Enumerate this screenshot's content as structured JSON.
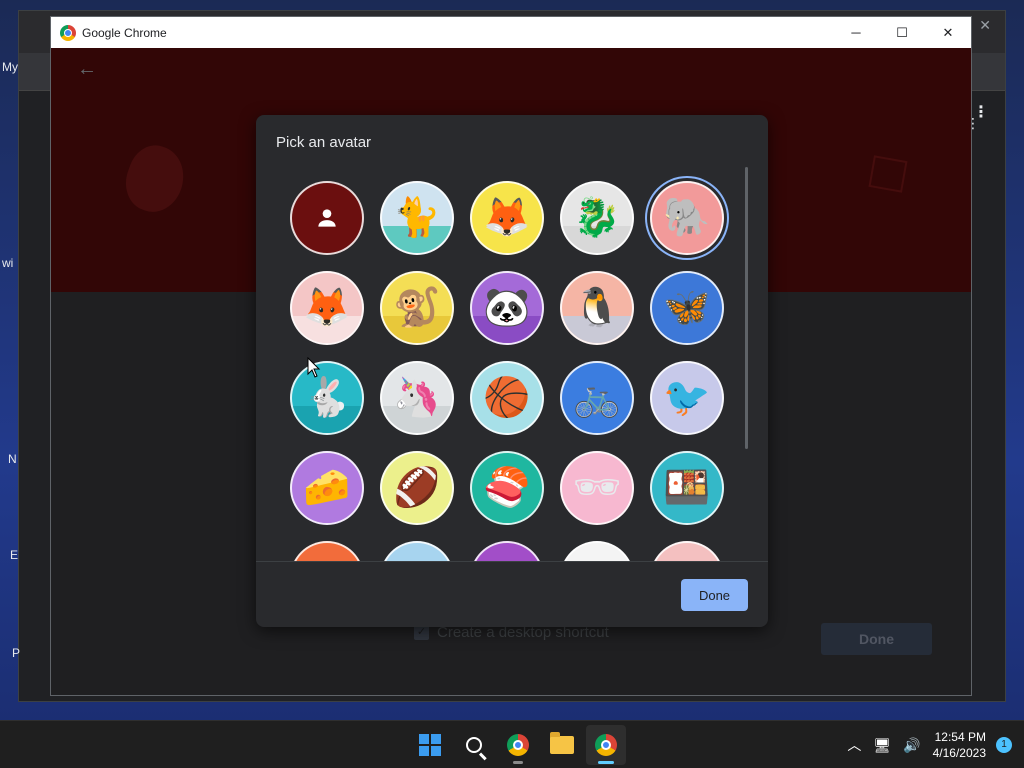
{
  "window": {
    "title": "Google Chrome"
  },
  "background": {
    "left_labels": [
      "My",
      "wi",
      "N",
      "E",
      "P"
    ]
  },
  "page": {
    "shortcut_label": "Create a desktop shortcut",
    "done_label": "Done"
  },
  "dialog": {
    "title": "Pick an avatar",
    "done_label": "Done",
    "avatars": [
      {
        "name": "generic-person",
        "glyph": "",
        "bg": "#6b0f0f",
        "ground": "",
        "selected": false
      },
      {
        "name": "cat",
        "glyph": "🐈",
        "bg": "#cfe3f0",
        "ground": "#5ec9c0",
        "selected": false
      },
      {
        "name": "fox-dog",
        "glyph": "🦊",
        "bg": "#f7e44a",
        "ground": "#f7e44a",
        "selected": false
      },
      {
        "name": "dragon",
        "glyph": "🐉",
        "bg": "#e6e6e6",
        "ground": "#d8d8d8",
        "selected": false
      },
      {
        "name": "elephant",
        "glyph": "🐘",
        "bg": "#f29a9a",
        "ground": "#f29a9a",
        "selected": true
      },
      {
        "name": "fox",
        "glyph": "🦊",
        "bg": "#f4c6c6",
        "ground": "#f7e0e0",
        "selected": false
      },
      {
        "name": "monkey",
        "glyph": "🐒",
        "bg": "#f4de55",
        "ground": "#e8c83a",
        "selected": false
      },
      {
        "name": "panda",
        "glyph": "🐼",
        "bg": "#a46ad8",
        "ground": "#8a4cc4",
        "selected": false
      },
      {
        "name": "penguin",
        "glyph": "🐧",
        "bg": "#f5b5a5",
        "ground": "#c9c9d6",
        "selected": false
      },
      {
        "name": "butterfly",
        "glyph": "🦋",
        "bg": "#3d78d8",
        "ground": "#3d78d8",
        "selected": false
      },
      {
        "name": "rabbit",
        "glyph": "🐇",
        "bg": "#27b9c7",
        "ground": "#1aa3b0",
        "selected": false
      },
      {
        "name": "unicorn",
        "glyph": "🦄",
        "bg": "#e3e6e8",
        "ground": "#cfd4d6",
        "selected": false
      },
      {
        "name": "basketball",
        "glyph": "🏀",
        "bg": "#a7e0e8",
        "ground": "#a7e0e8",
        "selected": false
      },
      {
        "name": "bicycle",
        "glyph": "🚲",
        "bg": "#3b7de0",
        "ground": "#3b7de0",
        "selected": false
      },
      {
        "name": "bird",
        "glyph": "🐦",
        "bg": "#c7c9ea",
        "ground": "#c7c9ea",
        "selected": false
      },
      {
        "name": "cheese",
        "glyph": "🧀",
        "bg": "#b07ae0",
        "ground": "#b07ae0",
        "selected": false
      },
      {
        "name": "football",
        "glyph": "🏈",
        "bg": "#ecf08c",
        "ground": "#ecf08c",
        "selected": false
      },
      {
        "name": "sushi-plate",
        "glyph": "🍣",
        "bg": "#1fb7a0",
        "ground": "#1fb7a0",
        "selected": false
      },
      {
        "name": "sunglasses",
        "glyph": "🕶",
        "bg": "#f7b8d0",
        "ground": "#f7b8d0",
        "selected": false
      },
      {
        "name": "sushi-roll",
        "glyph": "🍱",
        "bg": "#34b8c8",
        "ground": "#34b8c8",
        "selected": false
      },
      {
        "name": "partial-1",
        "glyph": "",
        "bg": "#f26c3b",
        "ground": "",
        "selected": false
      },
      {
        "name": "partial-2",
        "glyph": "",
        "bg": "#a7d4ef",
        "ground": "",
        "selected": false
      },
      {
        "name": "partial-3",
        "glyph": "",
        "bg": "#a24ec8",
        "ground": "",
        "selected": false
      },
      {
        "name": "partial-4",
        "glyph": "",
        "bg": "#f4f4f4",
        "ground": "",
        "selected": false
      },
      {
        "name": "partial-5",
        "glyph": "",
        "bg": "#f4c0c0",
        "ground": "",
        "selected": false
      }
    ]
  },
  "taskbar": {
    "time": "12:54 PM",
    "date": "4/16/2023",
    "notification_count": "1"
  }
}
